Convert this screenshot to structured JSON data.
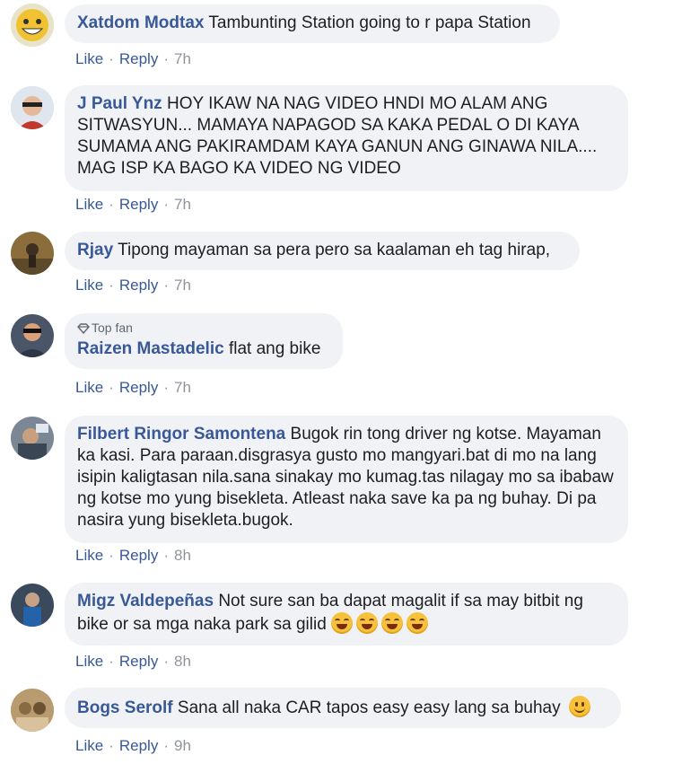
{
  "actions": {
    "like": "Like",
    "reply": "Reply",
    "separator": "·"
  },
  "colors": {
    "author": "#385898",
    "bubble": "#f0f2f5",
    "meta": "#90949c"
  },
  "comments": [
    {
      "author": "Xatdom Modtax",
      "text": "Tambunting Station going to r papa Station",
      "time": "7h"
    },
    {
      "author": "J Paul Ynz",
      "text": "HOY IKAW NA NAG VIDEO HNDI MO ALAM ANG SITWASYUN... MAMAYA NAPAGOD SA KAKA PEDAL O DI KAYA SUMAMA ANG PAKIRAMDAM KAYA GANUN ANG GINAWA NILA.... MAG ISP KA BAGO KA VIDEO NG VIDEO",
      "time": "7h"
    },
    {
      "author": "Rjay",
      "text": "Tipong mayaman sa pera pero sa kaalaman eh tag hirap,",
      "time": "7h"
    },
    {
      "author": "Raizen Mastadelic",
      "badge": "Top fan",
      "text": "flat ang bike",
      "time": "7h"
    },
    {
      "author": "Filbert Ringor Samontena",
      "text": "Bugok rin tong driver ng kotse. Mayaman ka kasi. Para paraan.disgrasya gusto mo mangyari.bat di mo na lang isipin kaligtasan nila.sana sinakay mo kumag.tas nilagay mo sa ibabaw ng kotse mo yung bisekleta. Atleast naka save ka pa ng buhay. Di pa nasira yung bisekleta.bugok.",
      "time": "8h"
    },
    {
      "author": "Migz Valdepeñas",
      "text": "Not sure san ba dapat magalit if sa may bitbit ng bike or sa mga naka park sa gilid",
      "emoji": "grinning-sweat-emoji",
      "emoji_count": 4,
      "time": "8h"
    },
    {
      "author": "Bogs Serolf",
      "text": "Sana all naka CAR tapos easy easy lang sa buhay",
      "emoji": "smile-emoji",
      "time": "9h"
    }
  ]
}
